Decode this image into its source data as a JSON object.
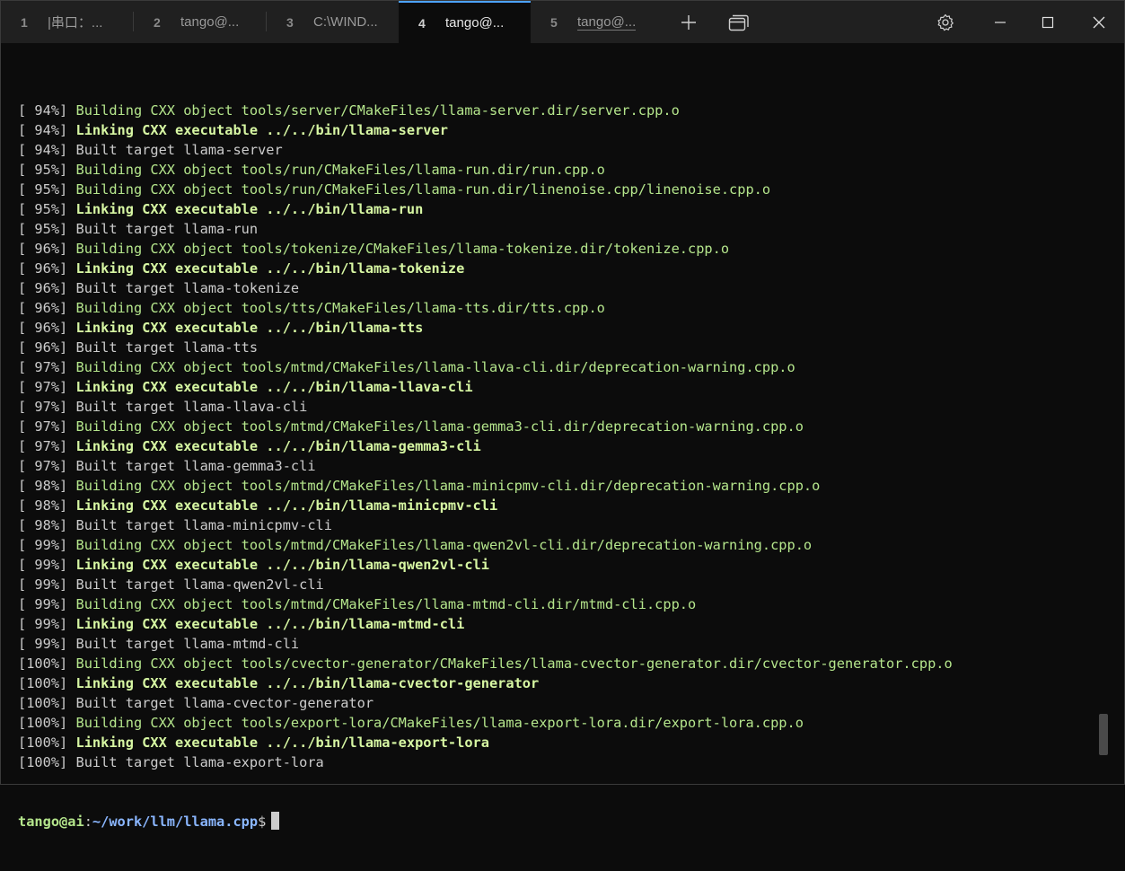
{
  "tabs": [
    {
      "num": "1",
      "title": "|串口：..."
    },
    {
      "num": "2",
      "title": "tango@..."
    },
    {
      "num": "3",
      "title": "C:\\WIND..."
    },
    {
      "num": "4",
      "title": "tango@..."
    },
    {
      "num": "5",
      "title": "tango@..."
    }
  ],
  "active_tab": 3,
  "icons": {
    "new_tab": "plus-icon",
    "dropdown": "window-stack-icon",
    "settings": "gear-icon",
    "minimize": "minimize-icon",
    "maximize": "maximize-icon",
    "close": "close-icon"
  },
  "colors": {
    "building": "#b5e68c",
    "linking": "#d7f7a3",
    "path": "#8ab6ff",
    "tab_accent": "#4da3ff"
  },
  "lines": [
    {
      "pct": "[ 94%]",
      "type": "build",
      "text": "Building CXX object tools/server/CMakeFiles/llama-server.dir/server.cpp.o"
    },
    {
      "pct": "[ 94%]",
      "type": "link",
      "text": "Linking CXX executable ../../bin/llama-server"
    },
    {
      "pct": "[ 94%]",
      "type": "built",
      "text": "Built target llama-server"
    },
    {
      "pct": "[ 95%]",
      "type": "build",
      "text": "Building CXX object tools/run/CMakeFiles/llama-run.dir/run.cpp.o"
    },
    {
      "pct": "[ 95%]",
      "type": "build",
      "text": "Building CXX object tools/run/CMakeFiles/llama-run.dir/linenoise.cpp/linenoise.cpp.o"
    },
    {
      "pct": "[ 95%]",
      "type": "link",
      "text": "Linking CXX executable ../../bin/llama-run"
    },
    {
      "pct": "[ 95%]",
      "type": "built",
      "text": "Built target llama-run"
    },
    {
      "pct": "[ 96%]",
      "type": "build",
      "text": "Building CXX object tools/tokenize/CMakeFiles/llama-tokenize.dir/tokenize.cpp.o"
    },
    {
      "pct": "[ 96%]",
      "type": "link",
      "text": "Linking CXX executable ../../bin/llama-tokenize"
    },
    {
      "pct": "[ 96%]",
      "type": "built",
      "text": "Built target llama-tokenize"
    },
    {
      "pct": "[ 96%]",
      "type": "build",
      "text": "Building CXX object tools/tts/CMakeFiles/llama-tts.dir/tts.cpp.o"
    },
    {
      "pct": "[ 96%]",
      "type": "link",
      "text": "Linking CXX executable ../../bin/llama-tts"
    },
    {
      "pct": "[ 96%]",
      "type": "built",
      "text": "Built target llama-tts"
    },
    {
      "pct": "[ 97%]",
      "type": "build",
      "text": "Building CXX object tools/mtmd/CMakeFiles/llama-llava-cli.dir/deprecation-warning.cpp.o"
    },
    {
      "pct": "[ 97%]",
      "type": "link",
      "text": "Linking CXX executable ../../bin/llama-llava-cli"
    },
    {
      "pct": "[ 97%]",
      "type": "built",
      "text": "Built target llama-llava-cli"
    },
    {
      "pct": "[ 97%]",
      "type": "build",
      "text": "Building CXX object tools/mtmd/CMakeFiles/llama-gemma3-cli.dir/deprecation-warning.cpp.o"
    },
    {
      "pct": "[ 97%]",
      "type": "link",
      "text": "Linking CXX executable ../../bin/llama-gemma3-cli"
    },
    {
      "pct": "[ 97%]",
      "type": "built",
      "text": "Built target llama-gemma3-cli"
    },
    {
      "pct": "[ 98%]",
      "type": "build",
      "text": "Building CXX object tools/mtmd/CMakeFiles/llama-minicpmv-cli.dir/deprecation-warning.cpp.o"
    },
    {
      "pct": "[ 98%]",
      "type": "link",
      "text": "Linking CXX executable ../../bin/llama-minicpmv-cli"
    },
    {
      "pct": "[ 98%]",
      "type": "built",
      "text": "Built target llama-minicpmv-cli"
    },
    {
      "pct": "[ 99%]",
      "type": "build",
      "text": "Building CXX object tools/mtmd/CMakeFiles/llama-qwen2vl-cli.dir/deprecation-warning.cpp.o"
    },
    {
      "pct": "[ 99%]",
      "type": "link",
      "text": "Linking CXX executable ../../bin/llama-qwen2vl-cli"
    },
    {
      "pct": "[ 99%]",
      "type": "built",
      "text": "Built target llama-qwen2vl-cli"
    },
    {
      "pct": "[ 99%]",
      "type": "build",
      "text": "Building CXX object tools/mtmd/CMakeFiles/llama-mtmd-cli.dir/mtmd-cli.cpp.o"
    },
    {
      "pct": "[ 99%]",
      "type": "link",
      "text": "Linking CXX executable ../../bin/llama-mtmd-cli"
    },
    {
      "pct": "[ 99%]",
      "type": "built",
      "text": "Built target llama-mtmd-cli"
    },
    {
      "pct": "[100%]",
      "type": "build",
      "text": "Building CXX object tools/cvector-generator/CMakeFiles/llama-cvector-generator.dir/cvector-generator.cpp.o"
    },
    {
      "pct": "[100%]",
      "type": "link",
      "text": "Linking CXX executable ../../bin/llama-cvector-generator"
    },
    {
      "pct": "[100%]",
      "type": "built",
      "text": "Built target llama-cvector-generator"
    },
    {
      "pct": "[100%]",
      "type": "build",
      "text": "Building CXX object tools/export-lora/CMakeFiles/llama-export-lora.dir/export-lora.cpp.o"
    },
    {
      "pct": "[100%]",
      "type": "link",
      "text": "Linking CXX executable ../../bin/llama-export-lora"
    },
    {
      "pct": "[100%]",
      "type": "built",
      "text": "Built target llama-export-lora"
    }
  ],
  "prompt": {
    "user_host": "tango@ai",
    "sep": ":",
    "path": "~/work/llm/llama.cpp",
    "symbol": "$"
  }
}
